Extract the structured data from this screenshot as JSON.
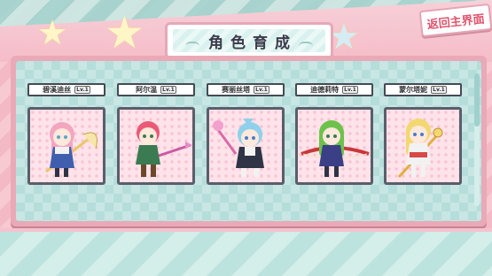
{
  "title": "角色育成",
  "return_label": "返回主界面",
  "characters": [
    {
      "name": "碧溪迪丝",
      "level": "Lv.1",
      "hair": "#f3a6c0",
      "outfit": "#3f5fae",
      "weapon": "#e8c86a"
    },
    {
      "name": "阿尔温",
      "level": "Lv.1",
      "hair": "#ea5a76",
      "outfit": "#3b7b52",
      "weapon": "#c85aa2"
    },
    {
      "name": "赛丽丝塔",
      "level": "Lv.1",
      "hair": "#8fd0ea",
      "outfit": "#2f3346",
      "weapon": "#d86aa8"
    },
    {
      "name": "迪德莉特",
      "level": "Lv.1",
      "hair": "#6cc24a",
      "outfit": "#3b3f86",
      "weapon": "#c8383a"
    },
    {
      "name": "蒙尔塔妮",
      "level": "Lv.1",
      "hair": "#f2d870",
      "outfit": "#d84848",
      "weapon": "#e0b040"
    }
  ],
  "colors": {
    "accent_pink": "#e9a9b7",
    "panel_teal": "#b5dedb",
    "return_text": "#e0556e"
  }
}
